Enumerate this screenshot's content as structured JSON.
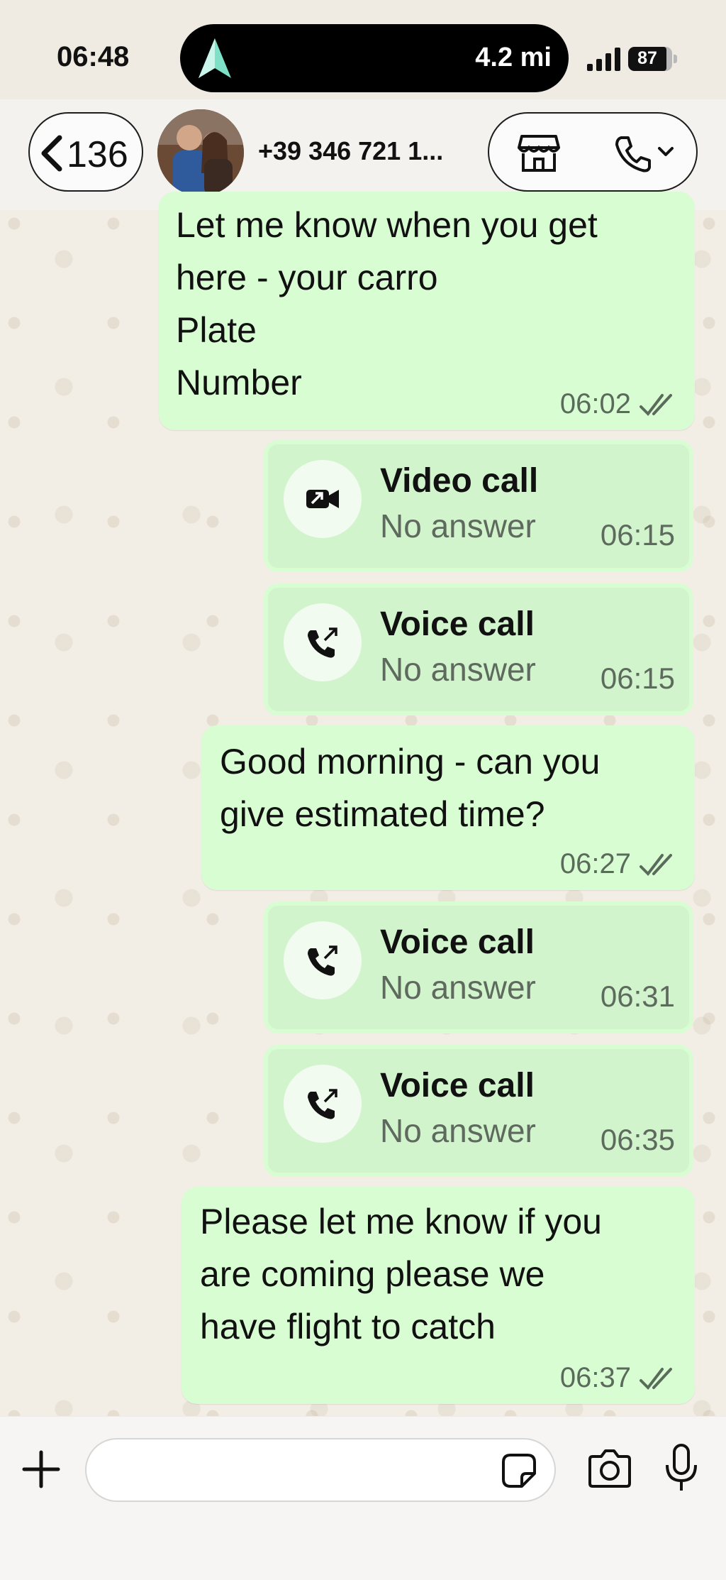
{
  "status_bar": {
    "time": "06:48",
    "island_distance": "4.2 mi",
    "battery_level": "87"
  },
  "header": {
    "back_count": "136",
    "contact_name": "+39 346 721 1..."
  },
  "messages": [
    {
      "type": "text",
      "text": "Let me know when you get\nhere - your carro\nPlate\nNumber",
      "time": "06:02",
      "read": true
    },
    {
      "type": "call",
      "title": "Video call",
      "status": "No answer",
      "time": "06:15",
      "call_kind": "video"
    },
    {
      "type": "call",
      "title": "Voice call",
      "status": "No answer",
      "time": "06:15",
      "call_kind": "voice"
    },
    {
      "type": "text",
      "text": "Good morning - can you\ngive estimated time?",
      "time": "06:27",
      "read": true
    },
    {
      "type": "call",
      "title": "Voice call",
      "status": "No answer",
      "time": "06:31",
      "call_kind": "voice"
    },
    {
      "type": "call",
      "title": "Voice call",
      "status": "No answer",
      "time": "06:35",
      "call_kind": "voice"
    },
    {
      "type": "text",
      "text": "Please let me know if you\nare coming please we\nhave flight to catch",
      "time": "06:37",
      "read": true
    }
  ],
  "composer": {
    "value": "",
    "placeholder": ""
  },
  "colors": {
    "bubble": "#d9fdd3",
    "call_card": "#d1f4cc",
    "read_ticks": "#5b6b5b"
  },
  "icons": [
    "nav-arrow-icon",
    "signal-icon",
    "chevron-left-icon",
    "store-icon",
    "phone-icon",
    "chevron-down-icon",
    "video-call-icon",
    "voice-call-icon",
    "double-check-icon",
    "plus-icon",
    "sticker-icon",
    "camera-icon",
    "mic-icon"
  ]
}
